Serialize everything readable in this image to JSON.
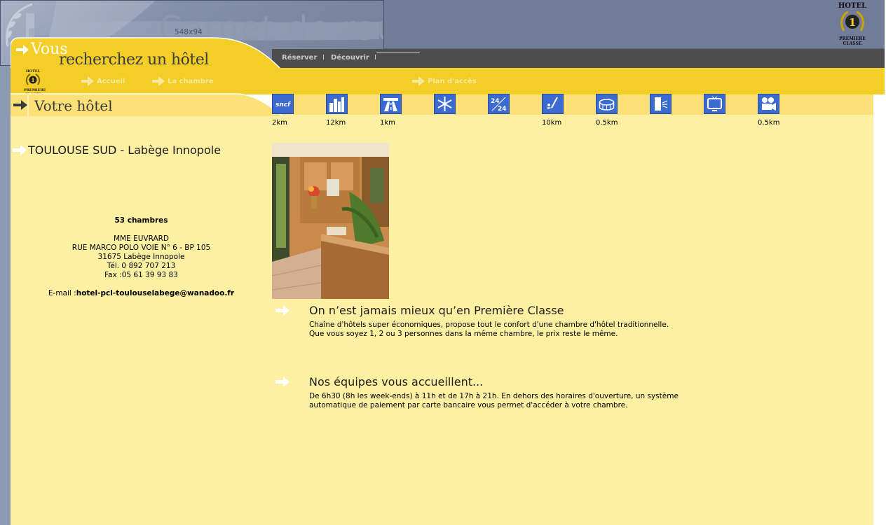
{
  "header": {
    "banner_size_label": "548x94",
    "banner_title": "Carnet de route",
    "logo_hotel": "HOTEL",
    "logo_number": "1",
    "logo_brand_1": "PREMIERE",
    "logo_brand_2": "CLASSE",
    "tagline_1": "Vous",
    "tagline_2": "recherchez un hôtel"
  },
  "nav": {
    "reserver": "Réserver",
    "decouvrir": "Découvrir",
    "separator": "I"
  },
  "subnav": {
    "accueil": "Accueil",
    "chambre": "La chambre",
    "plan": "Plan d'accès"
  },
  "section_title": "Votre hôtel",
  "services": [
    {
      "icon": "sncf-train-icon",
      "label": "sncf",
      "distance": "2km"
    },
    {
      "icon": "city-icon",
      "label": "",
      "distance": "12km"
    },
    {
      "icon": "highway-icon",
      "label": "",
      "distance": "1km"
    },
    {
      "icon": "snowflake-icon",
      "label": "",
      "distance": ""
    },
    {
      "icon": "24h-icon",
      "label": "24h/24h",
      "distance": ""
    },
    {
      "icon": "golf-icon",
      "label": "",
      "distance": "10km"
    },
    {
      "icon": "stadium-icon",
      "label": "",
      "distance": "0.5km"
    },
    {
      "icon": "theatre-icon",
      "label": "",
      "distance": ""
    },
    {
      "icon": "tv-icon",
      "label": "",
      "distance": ""
    },
    {
      "icon": "cinema-icon",
      "label": "",
      "distance": "0.5km"
    }
  ],
  "hotel": {
    "name": "TOULOUSE SUD - Labège Innopole",
    "rooms": "53 chambres",
    "manager": "MME EUVRARD",
    "address": "RUE MARCO POLO VOIE N° 6 - BP 105",
    "city": "31675 Labège Innopole",
    "tel": "Tél. 0 892 707 213",
    "fax": "Fax :05 61 39 93 83",
    "email_label": "E-mail :",
    "email": "hotel-pcl-toulouselabege@wanadoo.fr"
  },
  "sections": [
    {
      "title": "On n’est jamais mieux qu’en Première Classe",
      "line1": "Chaîne d'hôtels super économiques, propose tout le confort d'une chambre d'hôtel traditionnelle.",
      "line2": "Que vous soyez 1, 2 ou 3 personnes dans la même chambre, le prix reste le même."
    },
    {
      "title": "Nos équipes vous accueillent...",
      "line1": "De 6h30 (8h les week-ends) à 11h et de 17h à 21h. En dehors des horaires d'ouverture, un système automatique de paiement par carte bancaire vous permet d'accéder à votre chambre."
    }
  ],
  "colors": {
    "header_blue": "#717c98",
    "yellow": "#f2ce26",
    "panel": "#fef0a3",
    "icon_blue": "#3b6bd1"
  }
}
